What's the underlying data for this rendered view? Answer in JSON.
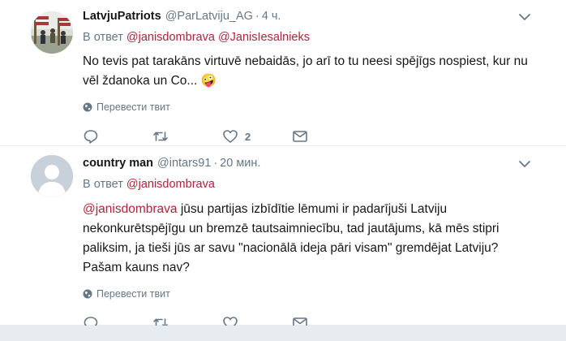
{
  "ui": {
    "translate_label": "Перевести твит",
    "replying_prefix": "В ответ"
  },
  "tweets": [
    {
      "fullname": "LatvjuPatriots",
      "username": "@ParLatviju_AG",
      "separator": "·",
      "time": "4 ч.",
      "replying_to": [
        "@janisdombrava",
        "@JanisIesalnieks"
      ],
      "text": "No tevis pat tarakāns virtuvē nebaidās, jo arī to tu neesi spējīgs nospiest, kur nu vēl ždanoka un Co... 🤪",
      "reply_count": "",
      "retweet_count": "",
      "like_count": "2"
    },
    {
      "fullname": "country man",
      "username": "@intars91",
      "separator": "·",
      "time": "20 мин.",
      "replying_to": [
        "@janisdombrava"
      ],
      "text_mention": "@janisdombrava",
      "text": " jūsu partijas izbīdītie lēmumi ir padarījuši Latviju nekonkurētspējīgu un bremzē tautsaimniecību, tad jautājums, kā mēs stipri paliksim, ja tieši jūs ar savu \"nacionālā ideja pāri visam\" gremdējat Latviju? Pašam kauns nav?",
      "reply_count": "",
      "retweet_count": "",
      "like_count": ""
    }
  ],
  "colors": {
    "mention": "#b0233c",
    "muted": "#657786",
    "text": "#14171a",
    "divider": "#e6ecf0"
  },
  "icons": [
    "reply-icon",
    "retweet-icon",
    "like-icon",
    "dm-icon",
    "caret-down-icon",
    "globe-icon",
    "default-avatar-icon"
  ]
}
